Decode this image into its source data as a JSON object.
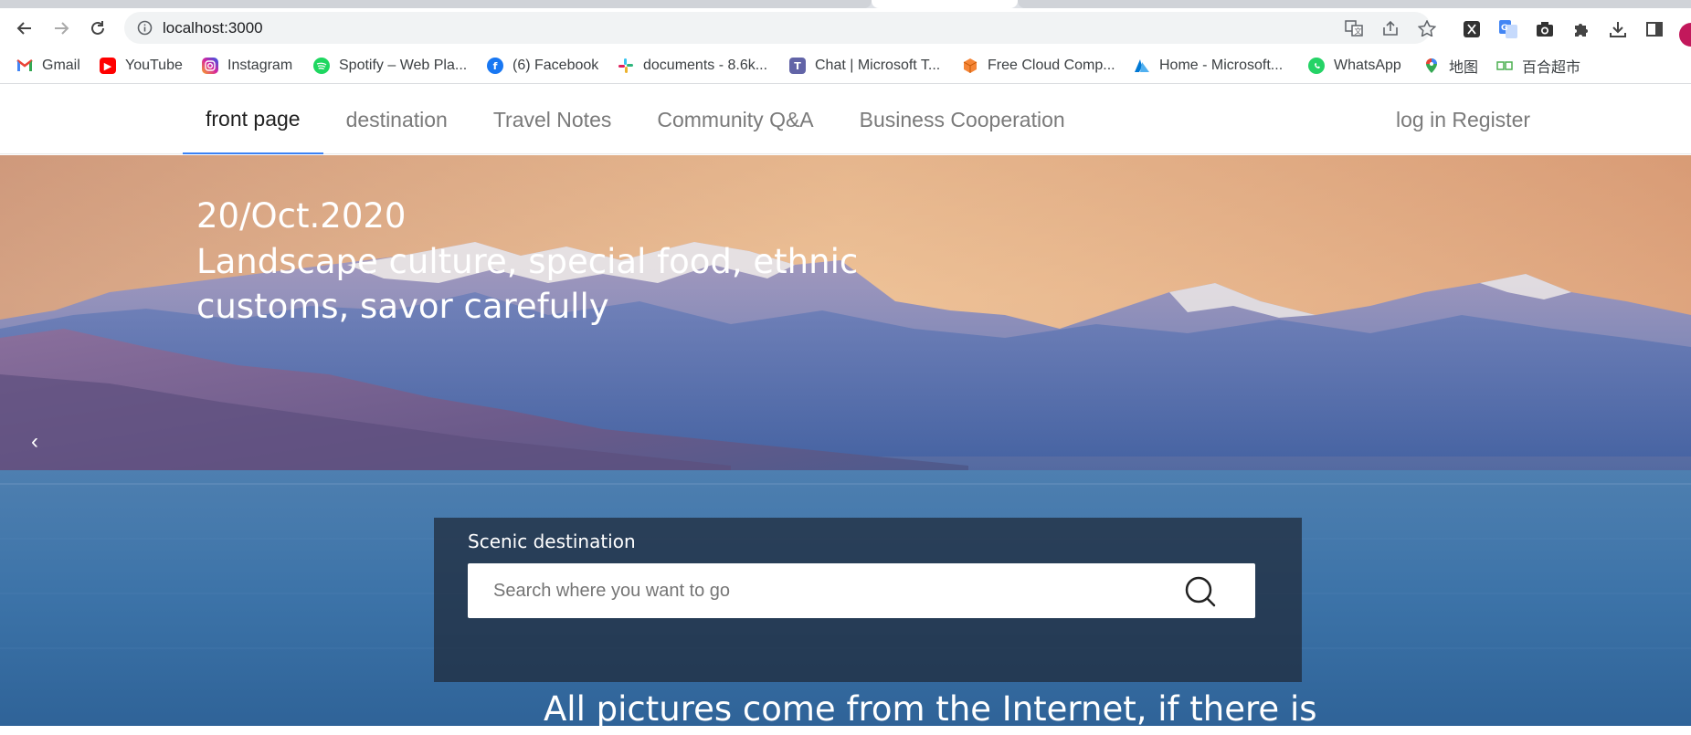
{
  "browser": {
    "url": "localhost:3000",
    "bookmarks": [
      {
        "label": "Gmail",
        "icon": "gmail-icon",
        "color": "#ea4335"
      },
      {
        "label": "YouTube",
        "icon": "youtube-icon",
        "color": "#ff0000"
      },
      {
        "label": "Instagram",
        "icon": "instagram-icon",
        "color": "#d6249f"
      },
      {
        "label": "Spotify – Web Pla...",
        "icon": "spotify-icon",
        "color": "#1ed760"
      },
      {
        "label": "(6) Facebook",
        "icon": "facebook-icon",
        "color": "#1877f2"
      },
      {
        "label": "documents - 8.6k...",
        "icon": "slack-icon",
        "color": "#e01e5a"
      },
      {
        "label": "Chat | Microsoft T...",
        "icon": "teams-icon",
        "color": "#6264a7"
      },
      {
        "label": "Free Cloud Comp...",
        "icon": "aws-cube-icon",
        "color": "#f58536"
      },
      {
        "label": "Home - Microsoft...",
        "icon": "azure-icon",
        "color": "#0078d4"
      },
      {
        "label": "WhatsApp",
        "icon": "whatsapp-icon",
        "color": "#25d366"
      },
      {
        "label": "地图",
        "icon": "maps-pin-icon",
        "color": "#34a853"
      },
      {
        "label": "百合超市",
        "icon": "store-icon",
        "color": "#4caf50"
      }
    ]
  },
  "nav": {
    "items": [
      {
        "label": "front page",
        "active": true
      },
      {
        "label": "destination",
        "active": false
      },
      {
        "label": "Travel Notes",
        "active": false
      },
      {
        "label": "Community Q&A",
        "active": false
      },
      {
        "label": "Business Cooperation",
        "active": false
      }
    ],
    "login": "log in",
    "register": "Register",
    "accent": "#3b82f6"
  },
  "hero": {
    "date": "20/Oct.2020",
    "tagline": "Landscape culture, special food, ethnic customs, savor carefully",
    "prev_arrow": "‹",
    "search": {
      "label": "Scenic destination",
      "placeholder": "Search where you want to go"
    },
    "footer_note": "All pictures come from the Internet, if there is"
  }
}
